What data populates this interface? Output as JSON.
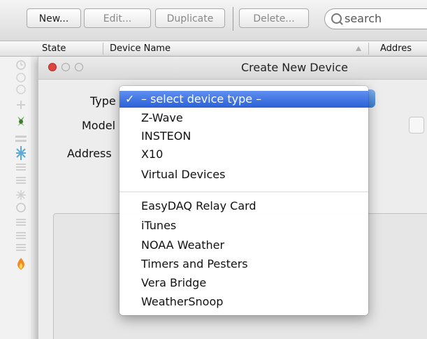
{
  "toolbar": {
    "new_label": "New...",
    "edit_label": "Edit...",
    "duplicate_label": "Duplicate",
    "delete_label": "Delete...",
    "search_placeholder": "search"
  },
  "table": {
    "columns": [
      "State",
      "Device Name",
      "Addres"
    ]
  },
  "dialog": {
    "title": "Create New Device",
    "type_label": "Type",
    "model_label": "Model",
    "address_label": "Address"
  },
  "menu": {
    "selected": "– select device type –",
    "group1": [
      "Z-Wave",
      "INSTEON",
      "X10",
      "Virtual Devices"
    ],
    "group2": [
      "EasyDAQ Relay Card",
      "iTunes",
      "NOAA Weather",
      "Timers and Pesters",
      "Vera Bridge",
      "WeatherSnoop"
    ]
  },
  "colors": {
    "selection": "#2b61d8",
    "close_light": "#e0443e"
  }
}
